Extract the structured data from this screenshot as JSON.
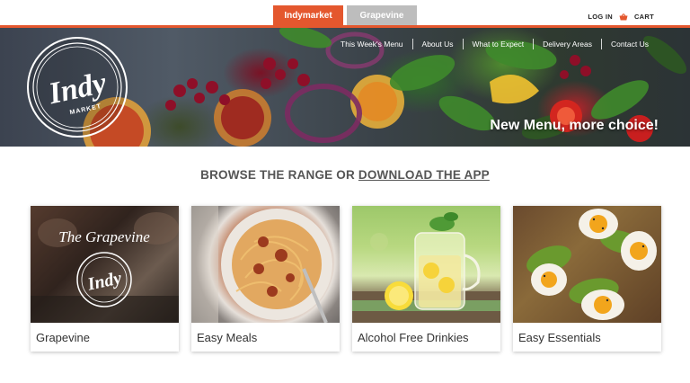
{
  "site_tabs": [
    {
      "label": "Indymarket",
      "active": true
    },
    {
      "label": "Grapevine",
      "active": false
    }
  ],
  "account": {
    "login": "LOG IN",
    "cart": "CART"
  },
  "nav": [
    {
      "label": "This Week's Menu"
    },
    {
      "label": "About Us"
    },
    {
      "label": "What to Expect"
    },
    {
      "label": "Delivery Areas"
    },
    {
      "label": "Contact Us"
    }
  ],
  "logo": {
    "main": "Indy",
    "sub": "MARKET"
  },
  "hero": {
    "tagline": "New Menu, more choice!"
  },
  "browse": {
    "prefix": "BROWSE THE RANGE OR ",
    "link": "DOWNLOAD THE APP"
  },
  "cards": [
    {
      "label": "Grapevine",
      "overlay_title": "The Grapevine",
      "overlay_logo": "Indy"
    },
    {
      "label": "Easy Meals"
    },
    {
      "label": "Alcohol Free Drinkies"
    },
    {
      "label": "Easy Essentials"
    }
  ],
  "colors": {
    "accent": "#e4572e",
    "inactive_tab": "#bdbdbd",
    "text": "#444444"
  }
}
